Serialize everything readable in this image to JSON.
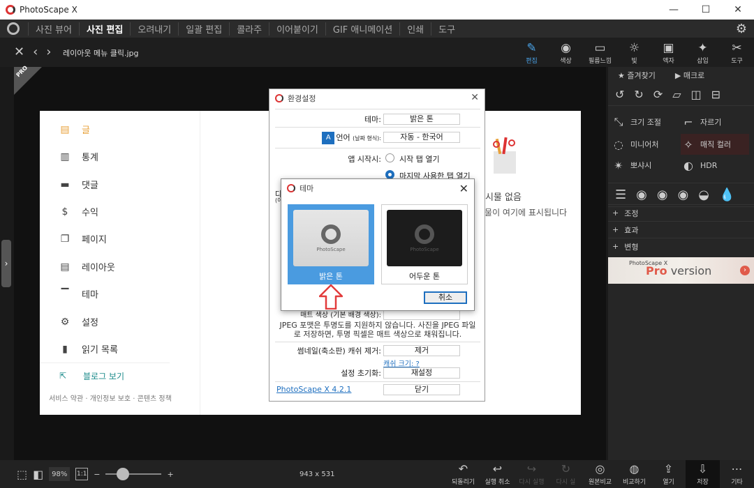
{
  "window": {
    "title": "PhotoScape X",
    "minimize": "—",
    "maximize": "☐",
    "close": "✕"
  },
  "menu": {
    "items": [
      "사진 뷰어",
      "사진 편집",
      "오려내기",
      "일괄 편집",
      "콜라주",
      "이어붙이기",
      "GIF 애니메이션",
      "인쇄",
      "도구"
    ],
    "active": 1
  },
  "toolbar": {
    "filename": "레이아웃 메뉴 클릭.jpg",
    "tools": [
      {
        "label": "편집",
        "icon": "✎"
      },
      {
        "label": "색상",
        "icon": "◉"
      },
      {
        "label": "필름느낌",
        "icon": "▭"
      },
      {
        "label": "빛",
        "icon": "☼"
      },
      {
        "label": "액자",
        "icon": "▣"
      },
      {
        "label": "삽입",
        "icon": "✦"
      },
      {
        "label": "도구",
        "icon": "✂"
      }
    ]
  },
  "pro_badge": "PRO",
  "page": {
    "sidebar": [
      {
        "label": "글",
        "icon": "▤"
      },
      {
        "label": "통계",
        "icon": "▥"
      },
      {
        "label": "댓글",
        "icon": "▬"
      },
      {
        "label": "수익",
        "icon": "$"
      },
      {
        "label": "페이지",
        "icon": "❐"
      },
      {
        "label": "레이아웃",
        "icon": "▤"
      },
      {
        "label": "테마",
        "icon": "▔"
      },
      {
        "label": "설정",
        "icon": "⚙"
      },
      {
        "label": "읽기 목록",
        "icon": "▮"
      }
    ],
    "blog_link": "블로그 보기",
    "footer": "서비스 약관 · 개인정보 보호 · 콘텐츠 정책",
    "empty_title": "게시물 없음",
    "empty_desc": "시물이 여기에 표시됩니다",
    "paren1": ")",
    "paren2": ")"
  },
  "settings": {
    "title": "환경설정",
    "theme_label": "테마:",
    "theme_value": "밝은 톤",
    "lang_label": "언어",
    "lang_sub": "(날짜 형식):",
    "lang_value": "자동 - 한국어",
    "start_label": "앱 시작시:",
    "start_opt1": "시작 탭 열기",
    "start_opt2": "마지막 사용한 탭 열기",
    "bg_label": "매트 색상 (기본 배경 색상):",
    "jpeg_note1": "JPEG 포맷은 투명도를 지원하지 않습니다. 사진을 JPEG 파일",
    "jpeg_note2": "로 저장하면, 투명 픽셀은 매트 색상으로 채워집니다.",
    "thumb_label": "썸네일(축소판) 캐쉬 제거:",
    "thumb_btn": "제거",
    "cache_link": "캐쉬 크기: ?",
    "reset_label": "설정 초기화:",
    "reset_btn": "재설정",
    "version_link": "PhotoScape X 4.2.1",
    "close_btn": "닫기",
    "left_cut1": "다",
    "left_cut2": "(이"
  },
  "theme_dialog": {
    "title": "테마",
    "light": "밝은 톤",
    "dark": "어두운 톤",
    "brand": "PhotoScape",
    "cancel": "취소"
  },
  "right_panel": {
    "favorites": "즐겨찾기",
    "macro": "매크로",
    "buttons": [
      {
        "label": "크기 조절",
        "icon": "⤡"
      },
      {
        "label": "자르기",
        "icon": "⌐"
      },
      {
        "label": "미니어처",
        "icon": "◌"
      },
      {
        "label": "매직 컬러",
        "icon": "✧"
      },
      {
        "label": "뽀샤시",
        "icon": "✴"
      },
      {
        "label": "HDR",
        "icon": "◐"
      }
    ],
    "sections": [
      "조정",
      "효과",
      "변형"
    ],
    "promo_small": "PhotoScape X",
    "promo_pro": "Pro",
    "promo_version": " version"
  },
  "bottom": {
    "zoom": "98%",
    "one_to_one": "1:1",
    "minus": "−",
    "plus": "+",
    "dims": "943 x 531",
    "actions": [
      {
        "label": "되돌리기",
        "icon": "↶",
        "dim": false
      },
      {
        "label": "실행 취소",
        "icon": "↩",
        "dim": false
      },
      {
        "label": "다시 실행",
        "icon": "↪",
        "dim": true
      },
      {
        "label": "다시 실",
        "icon": "↻",
        "dim": true
      },
      {
        "label": "원본비교",
        "icon": "◎",
        "dim": false
      },
      {
        "label": "비교하기",
        "icon": "◍",
        "dim": false
      },
      {
        "label": "열기",
        "icon": "⇪",
        "dim": false
      },
      {
        "label": "저장",
        "icon": "⇩",
        "dim": false
      },
      {
        "label": "기타",
        "icon": "⋯",
        "dim": false
      }
    ]
  },
  "colors": {
    "accent": "#4a9be0",
    "selected_card": "#4a9be0",
    "red_arrow": "#e23b3b",
    "active_item": "#e8a13a"
  }
}
